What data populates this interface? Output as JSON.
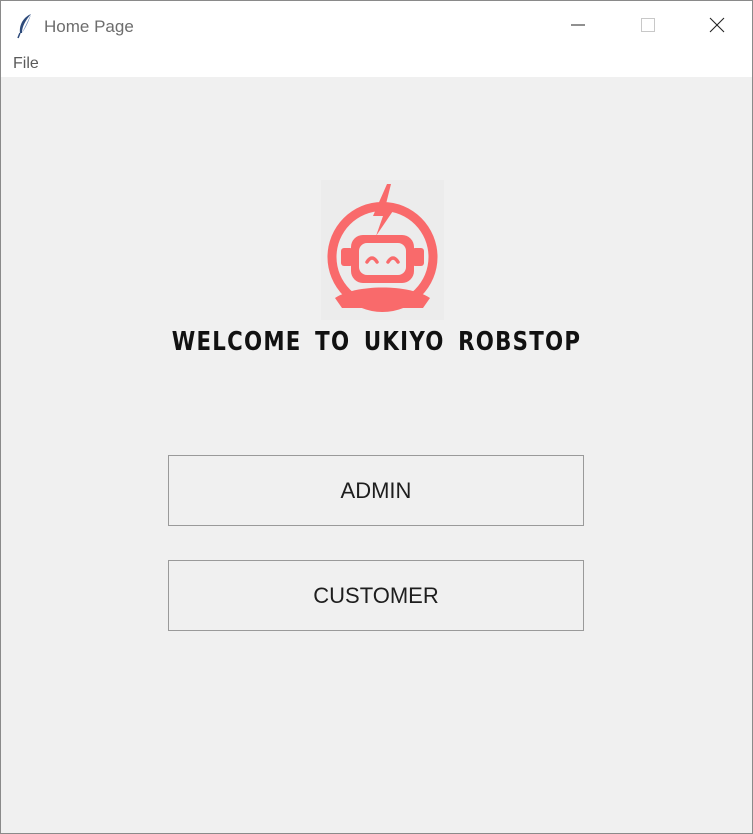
{
  "window": {
    "title": "Home Page",
    "icon": "feather-icon",
    "controls": [
      "minimize-icon",
      "maximize-icon",
      "close-icon"
    ]
  },
  "menubar": {
    "items": [
      {
        "label": "File"
      }
    ]
  },
  "main": {
    "logo_icon": "robot-logo-icon",
    "logo_color": "#f96a6b",
    "welcome_text": "WELCOME TO UKIYO ROBSTOP",
    "buttons": [
      {
        "label": "ADMIN"
      },
      {
        "label": "CUSTOMER"
      }
    ]
  }
}
